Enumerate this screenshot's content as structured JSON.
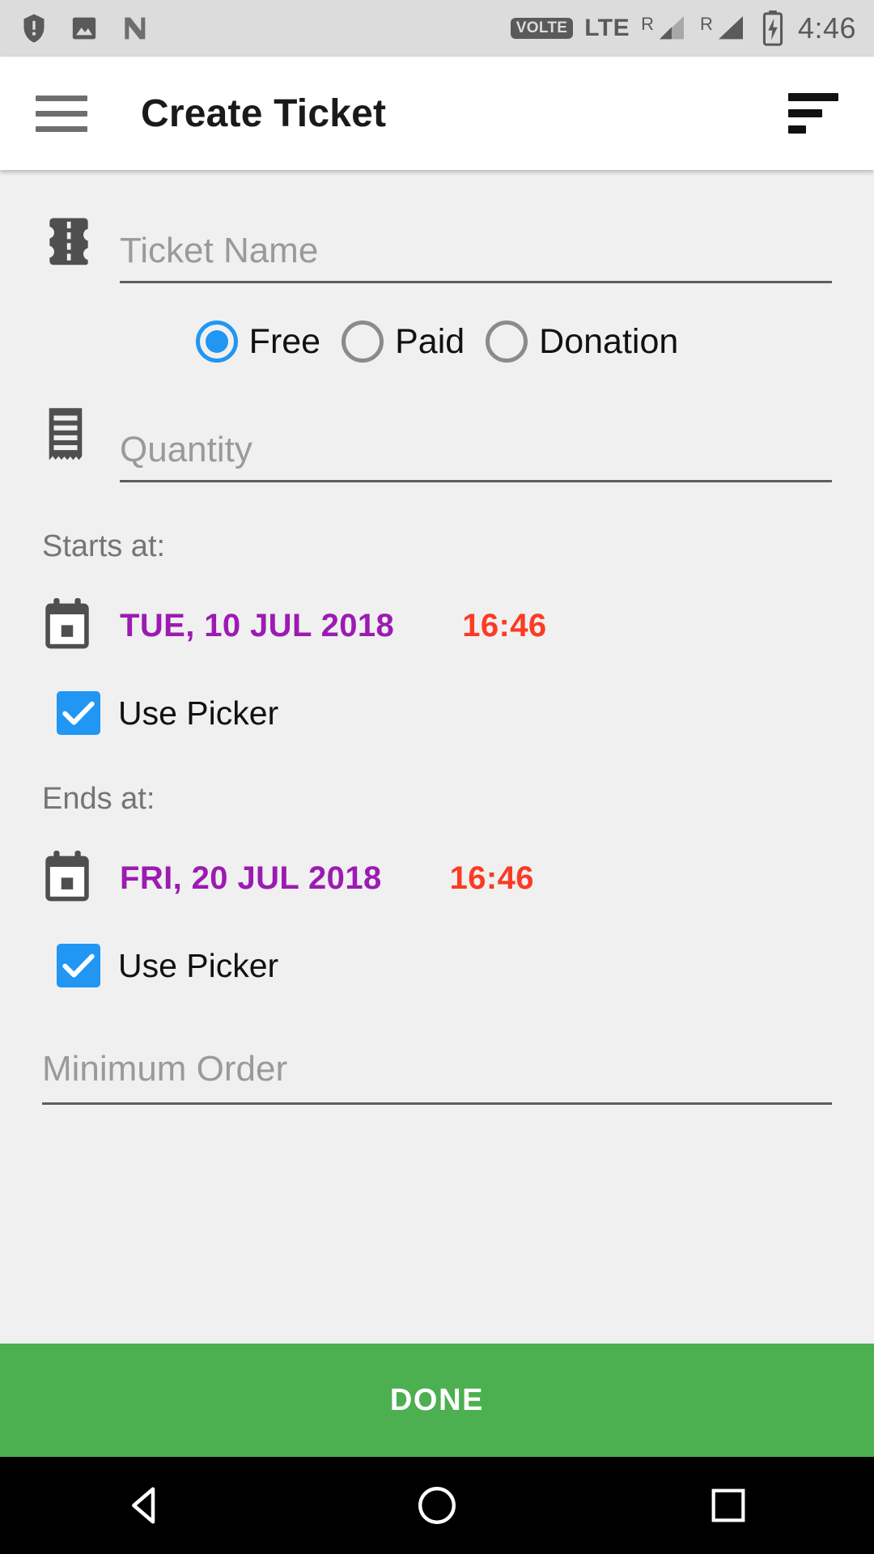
{
  "status_bar": {
    "icons_left": [
      "shield-alert-icon",
      "photo-icon",
      "nzb-icon"
    ],
    "volte_label": "VOLTE",
    "network_label": "LTE",
    "sim1_roaming": "R",
    "sim2_roaming": "R",
    "battery_icon": "battery-charging-icon",
    "time": "4:46"
  },
  "app_bar": {
    "menu_icon": "hamburger-menu-icon",
    "title": "Create Ticket",
    "action_icon": "sort-filter-icon"
  },
  "form": {
    "ticket_name": {
      "icon": "ticket-icon",
      "placeholder": "Ticket Name",
      "value": ""
    },
    "price_type": {
      "selected": "Free",
      "options": [
        {
          "label": "Free",
          "selected": true
        },
        {
          "label": "Paid",
          "selected": false
        },
        {
          "label": "Donation",
          "selected": false
        }
      ]
    },
    "quantity": {
      "icon": "receipt-icon",
      "placeholder": "Quantity",
      "value": ""
    },
    "starts_at": {
      "label": "Starts at:",
      "calendar_icon": "calendar-icon",
      "date": "TUE, 10 JUL 2018",
      "time": "16:46",
      "use_picker_label": "Use Picker",
      "use_picker_checked": true
    },
    "ends_at": {
      "label": "Ends at:",
      "calendar_icon": "calendar-icon",
      "date": "FRI, 20 JUL 2018",
      "time": "16:46",
      "use_picker_label": "Use Picker",
      "use_picker_checked": true
    },
    "minimum_order": {
      "placeholder": "Minimum Order",
      "value": ""
    }
  },
  "done_button": {
    "label": "DONE"
  },
  "nav_bar": {
    "back_icon": "back-triangle-icon",
    "home_icon": "home-circle-icon",
    "recents_icon": "recents-square-icon"
  },
  "colors": {
    "accent_blue": "#2196f3",
    "date_purple": "#9c1bb2",
    "time_red": "#fb3b24",
    "done_green": "#4caf50",
    "page_bg": "#f0f0f0",
    "status_bg": "#dcdcdc"
  }
}
